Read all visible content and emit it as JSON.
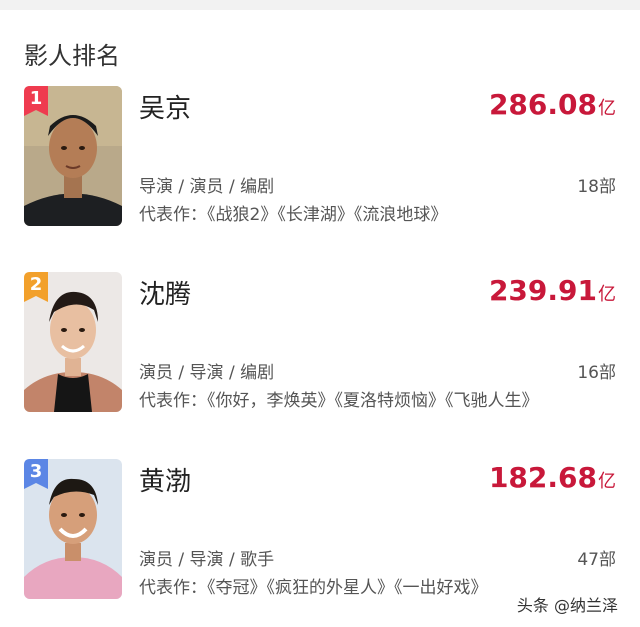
{
  "section": {
    "title": "影人排名"
  },
  "people": [
    {
      "rank": "1",
      "name": "吴京",
      "box_value": "286.08",
      "box_unit": "亿",
      "roles": "导演 / 演员 / 编剧",
      "count": "18部",
      "works": "代表作：《战狼2》《长津湖》《流浪地球》",
      "badge_color": "#ef3b4f"
    },
    {
      "rank": "2",
      "name": "沈腾",
      "box_value": "239.91",
      "box_unit": "亿",
      "roles": "演员 / 导演 / 编剧",
      "count": "16部",
      "works": "代表作：《你好，李焕英》《夏洛特烦恼》《飞驰人生》",
      "badge_color": "#f2a02b"
    },
    {
      "rank": "3",
      "name": "黄渤",
      "box_value": "182.68",
      "box_unit": "亿",
      "roles": "演员 / 导演 / 歌手",
      "count": "47部",
      "works": "代表作：《夺冠》《疯狂的外星人》《一出好戏》",
      "badge_color": "#5b86e5"
    }
  ],
  "watermark": "头条 @纳兰泽",
  "colors": {
    "accent": "#c8183a",
    "text": "#555555"
  }
}
